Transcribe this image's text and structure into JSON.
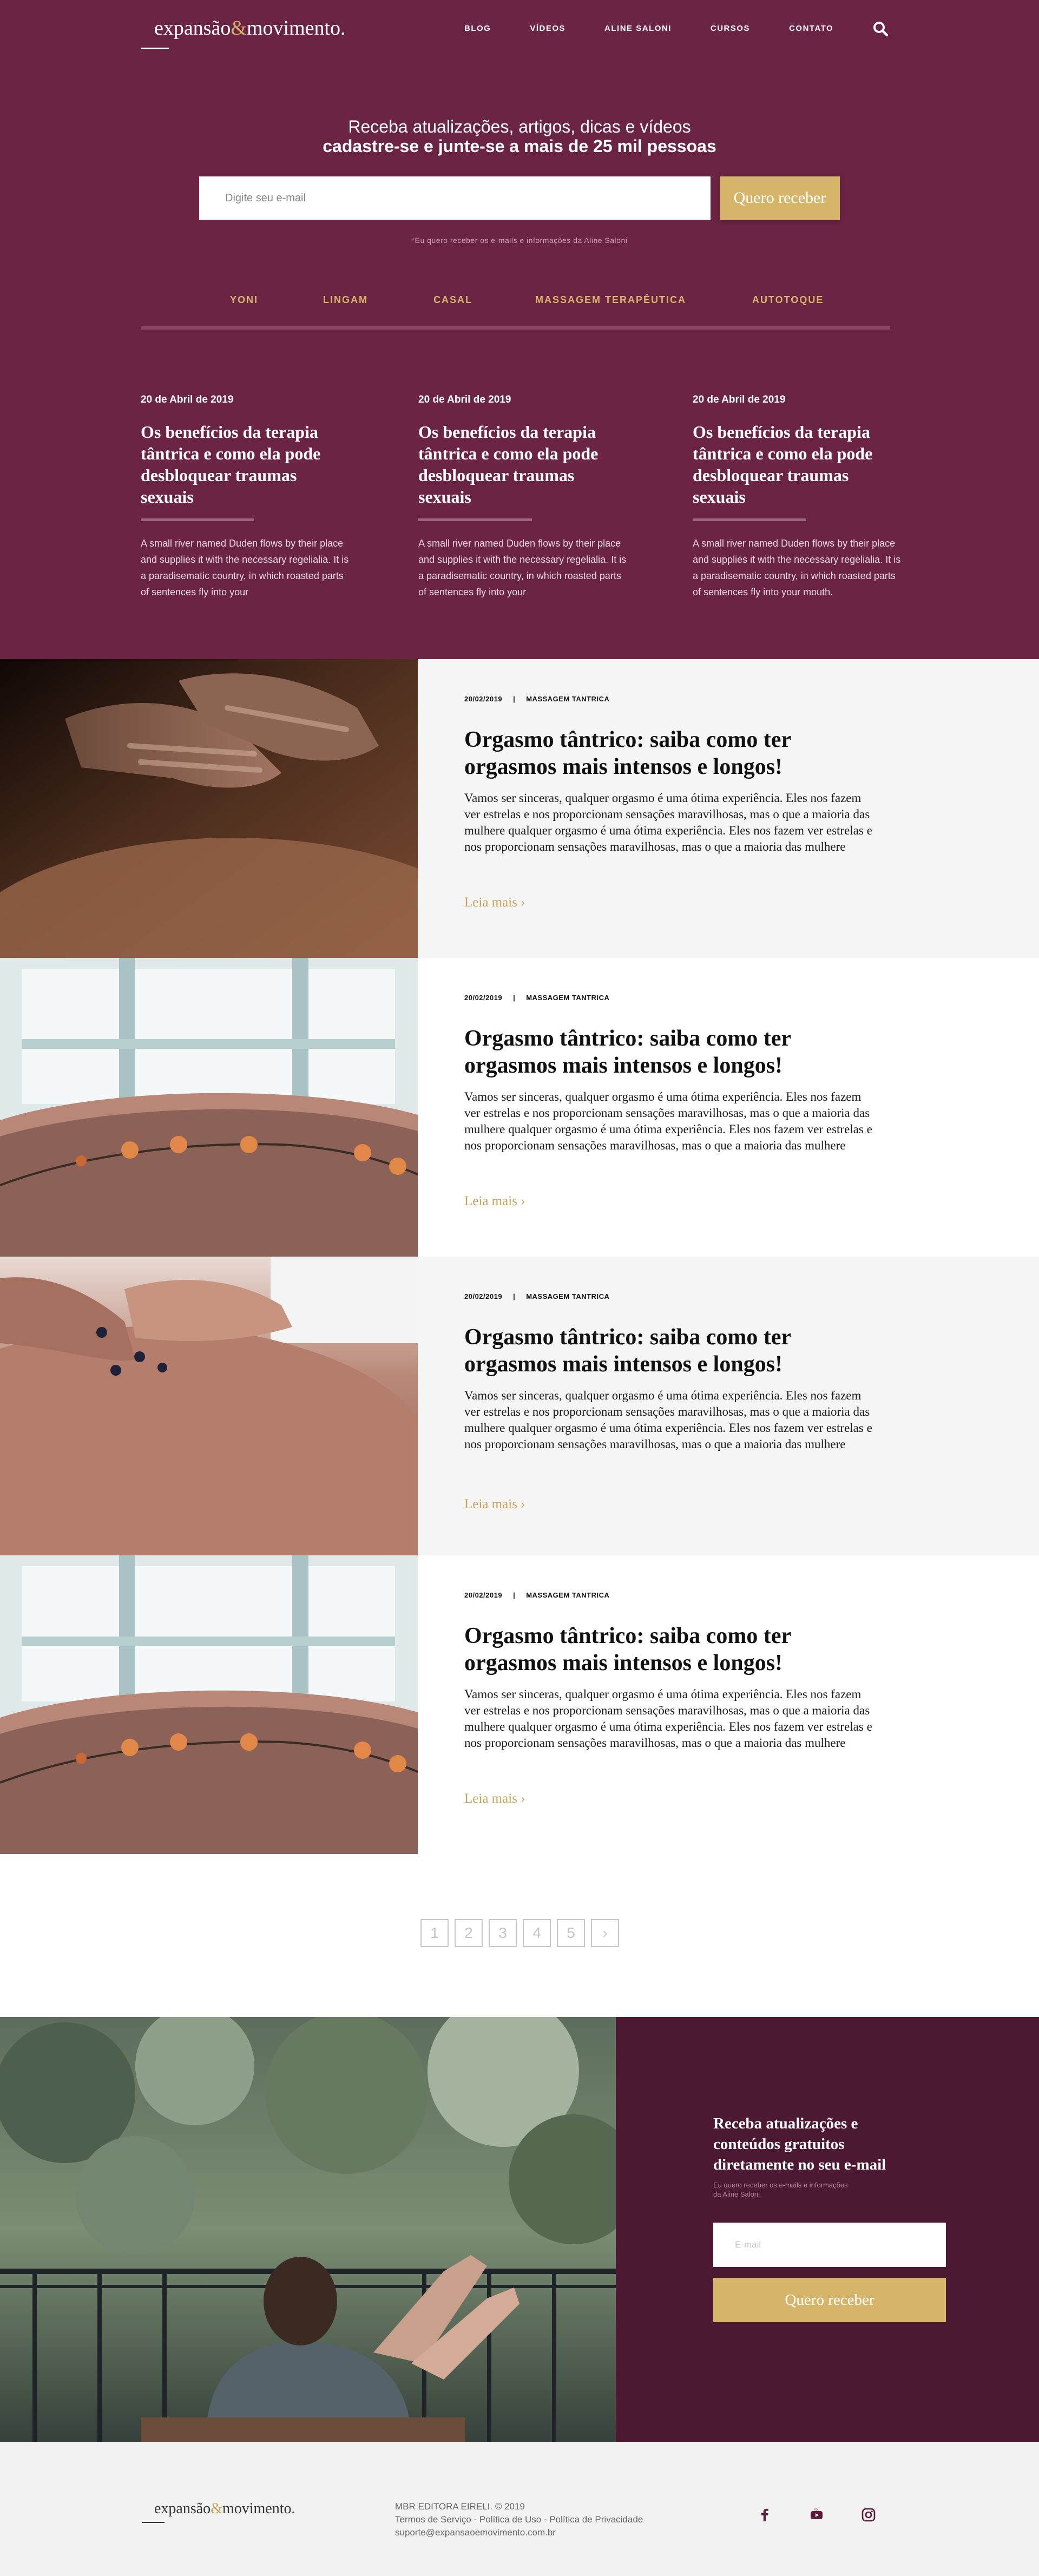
{
  "header": {
    "logo_word1": "expansão",
    "logo_amp": "&",
    "logo_word2": "movimento.",
    "nav": [
      "BLOG",
      "VÍDEOS",
      "ALINE SALONI",
      "CURSOS",
      "CONTATO"
    ]
  },
  "signup": {
    "line1": "Receba atualizações, artigos, dicas e vídeos",
    "line2": "cadastre-se e junte-se a mais de 25 mil pessoas",
    "placeholder": "Digite seu e-mail",
    "button": "Quero receber",
    "consent": "*Eu quero receber os e-mails e informações da Aline Saloni"
  },
  "categories": [
    "YONI",
    "LINGAM",
    "CASAL",
    "MASSAGEM TERAPÊUTICA",
    "AUTOTOQUE"
  ],
  "featured": [
    {
      "date": "20 de Abril de 2019",
      "title": "Os benefícios da terapia tântrica e como ela pode desbloquear traumas sexuais",
      "excerpt": "A small river named Duden flows by their place and supplies it with the necessary regelialia. It is a paradisematic country, in which roasted parts of sentences fly into your"
    },
    {
      "date": "20 de Abril de 2019",
      "title": "Os benefícios da terapia tântrica e como ela pode desbloquear traumas sexuais",
      "excerpt": "A small river named Duden flows by their place and supplies it with the necessary regelialia. It is a paradisematic country, in which roasted parts of sentences fly into your"
    },
    {
      "date": "20 de Abril de 2019",
      "title": "Os benefícios da terapia tântrica e como ela pode desbloquear traumas sexuais",
      "excerpt": "A small river named Duden flows by their place and supplies it with the necessary regelialia. It is a paradisematic country, in which roasted parts of sentences fly into your mouth."
    }
  ],
  "articles": [
    {
      "date": "20/02/2019",
      "category": "MASSAGEM TANTRICA",
      "title": "Orgasmo tântrico: saiba como ter orgasmos mais intensos e longos!",
      "text": "Vamos ser sinceras, qualquer orgasmo é uma ótima experiência. Eles nos fazem ver estrelas e nos proporcionam sensações maravilhosas, mas o que a maioria das mulhere qualquer orgasmo é uma ótima experiência. Eles nos fazem ver estrelas e nos proporcionam sensações maravilhosas, mas o que a maioria das mulhere",
      "more": "Leia mais",
      "image": "hands-massage-photo",
      "bg": "#f5f5f5"
    },
    {
      "date": "20/02/2019",
      "category": "MASSAGEM TANTRICA",
      "title": "Orgasmo tântrico: saiba como ter orgasmos mais intensos e longos!",
      "text": "Vamos ser sinceras, qualquer orgasmo é uma ótima experiência. Eles nos fazem ver estrelas e nos proporcionam sensações maravilhosas, mas o que a maioria das mulhere qualquer orgasmo é uma ótima experiência. Eles nos fazem ver estrelas e nos proporcionam sensações maravilhosas, mas o que a maioria das mulhere",
      "more": "Leia mais",
      "image": "flowers-on-back-photo",
      "bg": "#ffffff"
    },
    {
      "date": "20/02/2019",
      "category": "MASSAGEM TANTRICA",
      "title": "Orgasmo tântrico: saiba como ter orgasmos mais intensos e longos!",
      "text": "Vamos ser sinceras, qualquer orgasmo é uma ótima experiência. Eles nos fazem ver estrelas e nos proporcionam sensações maravilhosas, mas o que a maioria das mulhere qualquer orgasmo é uma ótima experiência. Eles nos fazem ver estrelas e nos proporcionam sensações maravilhosas, mas o que a maioria das mulhere",
      "more": "Leia mais",
      "image": "fingers-on-back-photo",
      "bg": "#f5f5f5"
    },
    {
      "date": "20/02/2019",
      "category": "MASSAGEM TANTRICA",
      "title": "Orgasmo tântrico: saiba como ter orgasmos mais intensos e longos!",
      "text": "Vamos ser sinceras, qualquer orgasmo é uma ótima experiência. Eles nos fazem ver estrelas e nos proporcionam sensações maravilhosas, mas o que a maioria das mulhere qualquer orgasmo é uma ótima experiência. Eles nos fazem ver estrelas e nos proporcionam sensações maravilhosas, mas o que a maioria das mulhere",
      "more": "Leia mais",
      "image": "flowers-on-back-photo",
      "bg": "#ffffff"
    }
  ],
  "pagination": [
    "1",
    "2",
    "3",
    "4",
    "5",
    "›"
  ],
  "newsletter": {
    "title": "Receba atualizações e conteúdos gratuitos diretamente no seu e-mail",
    "consent": "Eu quero receber os e-mails e informações da Aline Saloni",
    "placeholder": "E-mail",
    "button": "Quero receber",
    "image": "woman-relaxing-balcony-photo"
  },
  "footer": {
    "logo_word1": "expansão",
    "logo_amp": "&",
    "logo_word2": "movimento.",
    "company": "MBR EDITORA EIRELI. © 2019",
    "links": "Termos de Serviço - Política de Uso - Política de Privacidade",
    "email": "suporte@expansaoemovimento.com.br",
    "social": [
      "facebook-icon",
      "youtube-icon",
      "instagram-icon"
    ]
  },
  "colors": {
    "hero": "#6c2445",
    "gold": "#d6b56a",
    "newsletter_panel": "#4d1831"
  }
}
